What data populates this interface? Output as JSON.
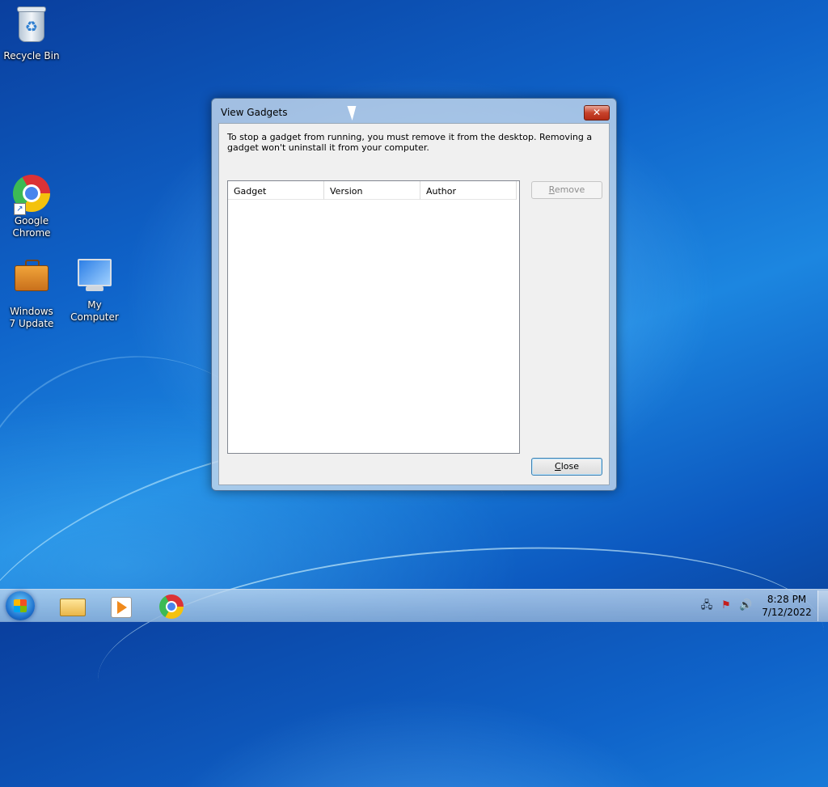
{
  "desktop": {
    "icons": [
      {
        "label": "Recycle Bin"
      },
      {
        "label": "Google Chrome"
      },
      {
        "label": "Windows 7 Update"
      },
      {
        "label": "My Computer"
      }
    ]
  },
  "dialog": {
    "title": "View Gadgets",
    "close_glyph": "✕",
    "description": "To stop a gadget from running, you must remove it from the desktop. Removing a gadget won't uninstall it from your computer.",
    "columns": [
      "Gadget",
      "Version",
      "Author"
    ],
    "remove_button": {
      "mnemonic": "R",
      "rest": "emove"
    },
    "close_button": {
      "mnemonic": "C",
      "rest": "lose"
    }
  },
  "taskbar": {
    "clock_time": "8:28 PM",
    "clock_date": "7/12/2022",
    "tray_icons": [
      "network-icon",
      "action-center-flag-icon",
      "volume-icon"
    ]
  }
}
